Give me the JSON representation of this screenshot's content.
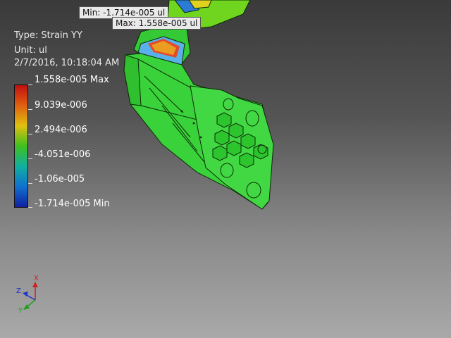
{
  "result_info": {
    "type_line": "Type: Strain YY",
    "unit_line": "Unit: ul",
    "date_line": "2/7/2016, 10:18:04 AM"
  },
  "legend": {
    "colors": [
      "#c01010",
      "#e06010",
      "#e0c010",
      "#40c020",
      "#10b0a0",
      "#1070d0",
      "#1020a0"
    ],
    "labels": [
      "1.558e-005 Max",
      "9.039e-006",
      "2.494e-006",
      "-4.051e-006",
      "-1.06e-005",
      "-1.714e-005 Min"
    ]
  },
  "probes": {
    "min_label": "Min: -1.714e-005 ul",
    "max_label": "Max: 1.558e-005 ul"
  },
  "triad": {
    "x_label": "X",
    "y_label": "Y",
    "z_label": "Z",
    "x_color": "#d02020",
    "y_color": "#20a020",
    "z_color": "#2030d0"
  }
}
